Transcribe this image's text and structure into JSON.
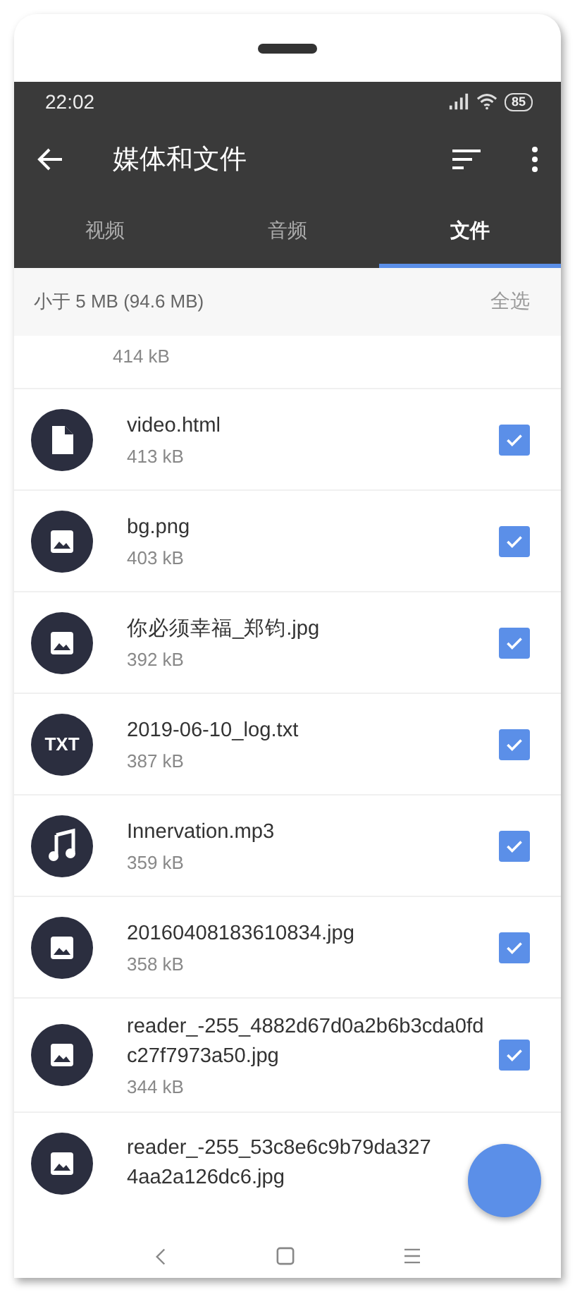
{
  "status_bar": {
    "time": "22:02",
    "battery": "85"
  },
  "app_bar": {
    "title": "媒体和文件"
  },
  "tabs": [
    {
      "label": "视频",
      "selected": false
    },
    {
      "label": "音频",
      "selected": false
    },
    {
      "label": "文件",
      "selected": true
    }
  ],
  "subheader": {
    "label": "小于 5 MB (94.6 MB)",
    "action": "全选"
  },
  "partial_row": {
    "size": "414 kB"
  },
  "files": [
    {
      "name": "video.html",
      "size": "413 kB",
      "kind": "file",
      "checked": true
    },
    {
      "name": "bg.png",
      "size": "403 kB",
      "kind": "image",
      "checked": true
    },
    {
      "name": "你必须幸福_郑钧.jpg",
      "size": "392 kB",
      "kind": "image",
      "checked": true
    },
    {
      "name": "2019-06-10_log.txt",
      "size": "387 kB",
      "kind": "txt",
      "badge": "TXT",
      "checked": true
    },
    {
      "name": "Innervation.mp3",
      "size": "359 kB",
      "kind": "music",
      "checked": true
    },
    {
      "name": "20160408183610834.jpg",
      "size": "358 kB",
      "kind": "image",
      "checked": true
    },
    {
      "name": "reader_-255_4882d67d0a2b6b3cda0fdc27f7973a50.jpg",
      "size": "344 kB",
      "kind": "image",
      "checked": true
    }
  ],
  "last_row": {
    "name_line_1": "reader_-255_53c8e6c9b79da327",
    "name_line_2": "4aa2a126dc6.jpg",
    "kind": "image"
  }
}
